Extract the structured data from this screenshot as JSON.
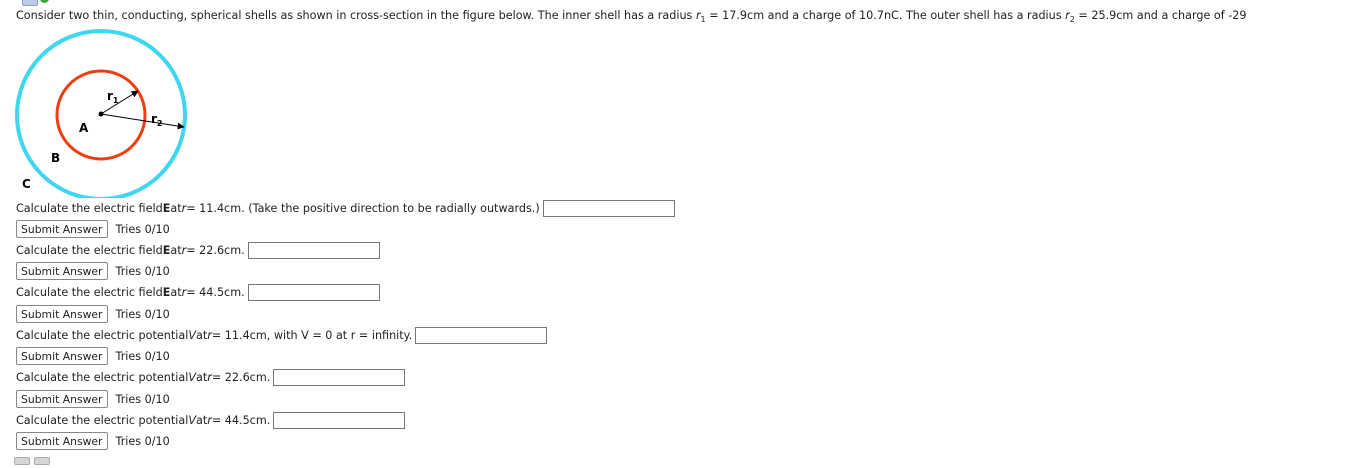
{
  "intro": {
    "p1": "Consider two thin, conducting, spherical shells as shown in cross-section in the figure below. The inner shell has a radius ",
    "r1_label": "r",
    "r1_sub": "1",
    "p2": " = 17.9cm and a charge of 10.7nC. The outer shell has a radius ",
    "r2_label": "r",
    "r2_sub": "2",
    "p3": " = 25.9cm and a charge of -29"
  },
  "figure": {
    "label_r1": "r",
    "label_r1_sub": "1",
    "label_r2": "r",
    "label_r2_sub": "2",
    "label_a": "A",
    "label_b": "B",
    "label_c": "C",
    "outer_color": "#3fd7f0",
    "inner_color": "#ef3d12"
  },
  "questions": [
    {
      "pre": "Calculate the electric field ",
      "sym": "E",
      "mid": " at ",
      "var": "r",
      "post": " = 11.4cm. (Take the positive direction to be radially outwards.)",
      "value": "",
      "button": "Submit Answer",
      "tries": "Tries 0/10"
    },
    {
      "pre": "Calculate the electric field ",
      "sym": "E",
      "mid": " at ",
      "var": "r",
      "post": " = 22.6cm.",
      "value": "",
      "button": "Submit Answer",
      "tries": "Tries 0/10"
    },
    {
      "pre": "Calculate the electric field ",
      "sym": "E",
      "mid": " at ",
      "var": "r",
      "post": " = 44.5cm.",
      "value": "",
      "button": "Submit Answer",
      "tries": "Tries 0/10"
    },
    {
      "pre": "Calculate the electric potential ",
      "sym": "V",
      "mid": " at ",
      "var": "r",
      "post": " = 11.4cm, with V = 0 at r = infinity.",
      "value": "",
      "button": "Submit Answer",
      "tries": "Tries 0/10"
    },
    {
      "pre": "Calculate the electric potential ",
      "sym": "V",
      "mid": " at ",
      "var": "r",
      "post": " = 22.6cm.",
      "value": "",
      "button": "Submit Answer",
      "tries": "Tries 0/10"
    },
    {
      "pre": "Calculate the electric potential ",
      "sym": "V",
      "mid": " at ",
      "var": "r",
      "post": " = 44.5cm.",
      "value": "",
      "button": "Submit Answer",
      "tries": "Tries 0/10"
    }
  ]
}
